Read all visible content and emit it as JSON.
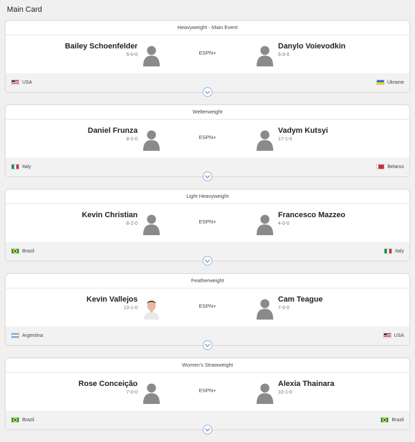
{
  "section_title": "Main Card",
  "fights": [
    {
      "weight_class": "Heavyweight - Main Event",
      "broadcast": "ESPN+",
      "red": {
        "name": "Bailey Schoenfelder",
        "record": "5-0-0",
        "country": "USA",
        "flag": "usa",
        "photo": "placeholder"
      },
      "blue": {
        "name": "Danylo Voievodkin",
        "record": "6-0-0",
        "country": "Ukraine",
        "flag": "ukraine",
        "photo": "placeholder"
      }
    },
    {
      "weight_class": "Welterweight",
      "broadcast": "ESPN+",
      "red": {
        "name": "Daniel Frunza",
        "record": "8-2-0",
        "country": "Italy",
        "flag": "italy",
        "photo": "placeholder"
      },
      "blue": {
        "name": "Vadym Kutsyi",
        "record": "17-1-0",
        "country": "Belarus",
        "flag": "belarus",
        "photo": "placeholder"
      }
    },
    {
      "weight_class": "Light Heavyweight",
      "broadcast": "ESPN+",
      "red": {
        "name": "Kevin Christian",
        "record": "8-2-0",
        "country": "Brazil",
        "flag": "brazil",
        "photo": "placeholder"
      },
      "blue": {
        "name": "Francesco Mazzeo",
        "record": "4-0-0",
        "country": "Italy",
        "flag": "italy",
        "photo": "placeholder"
      }
    },
    {
      "weight_class": "Featherweight",
      "broadcast": "ESPN+",
      "red": {
        "name": "Kevin Vallejos",
        "record": "13-1-0",
        "country": "Argentina",
        "flag": "argentina",
        "photo": "headshot"
      },
      "blue": {
        "name": "Cam Teague",
        "record": "7-0-0",
        "country": "USA",
        "flag": "usa",
        "photo": "placeholder"
      }
    },
    {
      "weight_class": "Women's Strawweight",
      "broadcast": "ESPN+",
      "red": {
        "name": "Rose Conceição",
        "record": "7-0-0",
        "country": "Brazil",
        "flag": "brazil",
        "photo": "placeholder"
      },
      "blue": {
        "name": "Alexia Thainara",
        "record": "10-1-0",
        "country": "Brazil",
        "flag": "brazil",
        "photo": "placeholder"
      }
    }
  ],
  "icons": {
    "avatar": "person-silhouette-icon",
    "expand": "chevron-down-icon"
  },
  "colors": {
    "accent": "#5b8fc7",
    "silhouette": "#8a8a8a",
    "footer_bg": "#f2f2f2"
  }
}
